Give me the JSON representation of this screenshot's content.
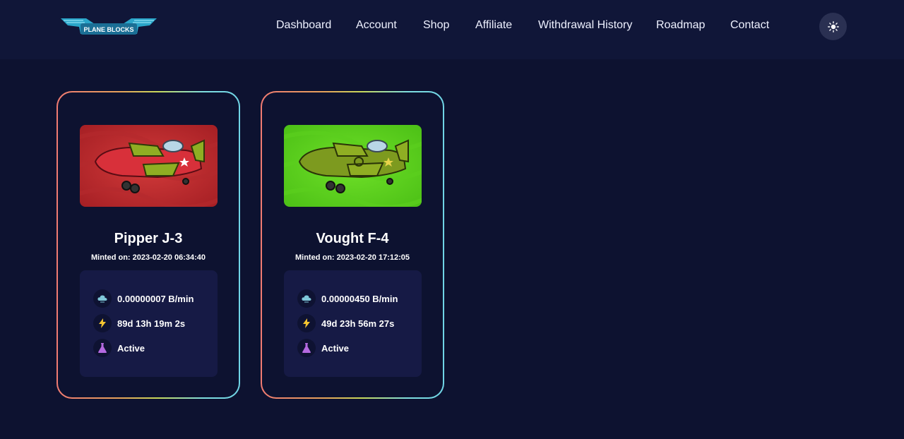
{
  "brand": {
    "logo_text": "PLANE BLOCKS"
  },
  "nav": {
    "items": [
      {
        "label": "Dashboard"
      },
      {
        "label": "Account"
      },
      {
        "label": "Shop"
      },
      {
        "label": "Affiliate"
      },
      {
        "label": "Withdrawal History"
      },
      {
        "label": "Roadmap"
      },
      {
        "label": "Contact"
      }
    ]
  },
  "icons": {
    "theme": "sun-icon",
    "rate": "cloud-icon",
    "time": "lightning-icon",
    "status": "flask-icon"
  },
  "colors": {
    "background": "#0d1230",
    "navbar": "#101638",
    "stats_panel": "#161a45",
    "card_border_start": "#f07a72",
    "card_border_end": "#6fd4e6",
    "plane_red_bg": "#c4282b",
    "plane_green_bg": "#5ed41f"
  },
  "cards": [
    {
      "name": "Pipper J-3",
      "minted": "Minted on: 2023-02-20 06:34:40",
      "rate": "0.00000007 B/min",
      "time_left": "89d 13h 19m 2s",
      "status": "Active"
    },
    {
      "name": "Vought F-4",
      "minted": "Minted on: 2023-02-20 17:12:05",
      "rate": "0.00000450 B/min",
      "time_left": "49d 23h 56m 27s",
      "status": "Active"
    }
  ]
}
